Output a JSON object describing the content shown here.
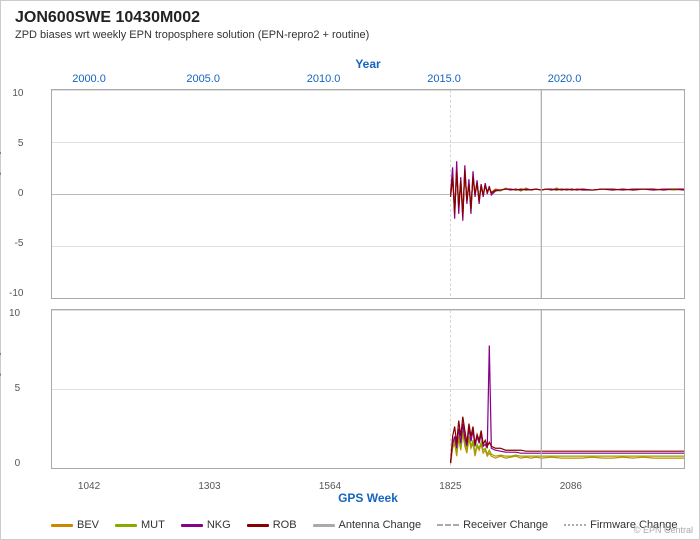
{
  "title": "JON600SWE 10430M002",
  "subtitle": "ZPD biases wrt weekly EPN troposphere solution (EPN-repro2 + routine)",
  "year_axis_title": "Year",
  "gps_week_title": "GPS Week",
  "years": [
    {
      "label": "2000.0",
      "pct": 0.06
    },
    {
      "label": "2005.0",
      "pct": 0.24
    },
    {
      "label": "2010.0",
      "pct": 0.43
    },
    {
      "label": "2015.0",
      "pct": 0.62
    },
    {
      "label": "2020.0",
      "pct": 0.81
    }
  ],
  "gps_weeks": [
    {
      "label": "1042",
      "pct": 0.06
    },
    {
      "label": "1303",
      "pct": 0.25
    },
    {
      "label": "1564",
      "pct": 0.44
    },
    {
      "label": "1825",
      "pct": 0.63
    },
    {
      "label": "2086",
      "pct": 0.82
    }
  ],
  "upper_y_ticks": [
    "10",
    "5",
    "0",
    "-5",
    "-10"
  ],
  "lower_y_ticks": [
    "10",
    "5",
    "0"
  ],
  "y_title_upper": "ZPD Biases [mm]",
  "y_title_lower": "ZPD STD [mm]",
  "legend": [
    {
      "label": "BEV",
      "color": "#cc8800",
      "style": "solid"
    },
    {
      "label": "MUT",
      "color": "#88aa00",
      "style": "solid"
    },
    {
      "label": "NKG",
      "color": "#880088",
      "style": "solid"
    },
    {
      "label": "ROB",
      "color": "#880000",
      "style": "solid"
    },
    {
      "label": "Antenna Change",
      "color": "#aaaaaa",
      "style": "solid"
    },
    {
      "label": "Receiver Change",
      "color": "#aaaaaa",
      "style": "dashed"
    },
    {
      "label": "Firmware Change",
      "color": "#aaaaaa",
      "style": "dotted"
    }
  ],
  "epn_credit": "© EPN Central"
}
